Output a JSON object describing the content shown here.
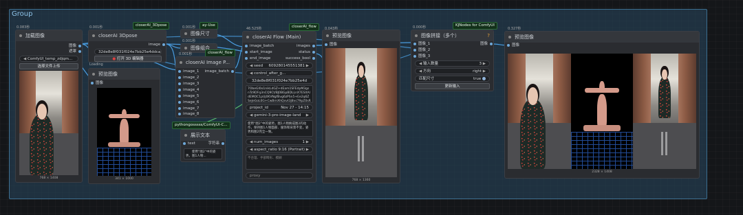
{
  "group": {
    "title": "Group"
  },
  "nodes": {
    "load_image": {
      "timer": "0.083秒",
      "title": "加载图像",
      "out_image": "图像",
      "out_mask": "遮罩",
      "file": "ComfyUI_temp_zdjqm...",
      "upload": "选择文件上传",
      "caption": "768 × 1408"
    },
    "load3d": {
      "timer": "0.001秒",
      "badge": "closerAI_3Dpose",
      "title": "closerAI 3Dpose",
      "out_image": "image",
      "hash": "32de8e8f031f024e7bb25e4ddca...",
      "open_editor": "打开 3D 编辑器",
      "extra": "Loading"
    },
    "preview_left": {
      "title": "预览图像",
      "in_images": "图像",
      "caption": "341 × 1000"
    },
    "image_size": {
      "timer": "0.001秒",
      "badge_fragment": "ay-Use",
      "title": "图像尺寸"
    },
    "image_combine": {
      "timer": "0.001秒",
      "title": "图像组合"
    },
    "closerai_image": {
      "timer": "0.001秒",
      "badge": "closerAI_flow",
      "title": "closerAI Image P...",
      "inputs": [
        "image_1",
        "image_2",
        "image_3",
        "image_4",
        "image_5",
        "image_6",
        "image_7",
        "image_8"
      ],
      "out": "image_batch"
    },
    "show_text": {
      "badge": "pythongosssss/ComfyUI-C...",
      "title": "展示文本",
      "in_text": "text",
      "out_text": "字符串",
      "content": "　　使用“图2”中的姿势，图1人物..."
    },
    "closerai_flow": {
      "timer": "46.525秒",
      "badge": "closerAI_flow",
      "title": "closerAI Flow (Main)",
      "inputs": [
        "image_batch",
        "start_image",
        "end_image"
      ],
      "outputs": [
        "images",
        "status",
        "success_bool"
      ],
      "seed_label": "seed",
      "seed_value": "609280145551381",
      "cafter_label": "control_after_g...",
      "cafter_value": "randomize",
      "hash": "32de8e8f031f024e7bb25e4d",
      "payload": "7ObeGl0o1nikLdGZ+dEam1SFEdpM3gsnTc9DFq3nCQ9Ct/BJ0BGpBDLLnX7ESXAldEMOC1pUj0KVNgfBvg6zPSn5+Ee2q6ZSeJeGoL0G+CwBrnXhQxvt3j8vc79pZ0sRaQ5rF2NsBbuJtOqWvMFuh1CXpOq",
      "project_id_label": "project_id",
      "project_id_value": "Nov 27 - 14:15",
      "model": "gemini-3-pro-image-land",
      "prompt": "使用“图2”中的姿势，图1人物换成图2的动作，保持图1人物面部、服饰和背景不变，姿势和图2完全一致。",
      "num_images_label": "num_images",
      "num_images_value": "1",
      "aspect_ratio_label": "aspect_ratio",
      "aspect_ratio_value": "9:16 (Portrait)",
      "negative": "不合理、手部畸形、模糊",
      "proxy": "proxy"
    },
    "preview_center": {
      "timer": "0.043秒",
      "title": "预览图像",
      "in_images": "图像",
      "caption": "768 × 1360"
    },
    "image_stitch": {
      "timer": "0.000秒",
      "badge": "KJNodes for ComfyUI",
      "title": "图像拼接（多个）",
      "inputs": [
        "图像_1",
        "图像_2",
        "图像_3"
      ],
      "out": "图像",
      "w_inputs_label": "输入数量",
      "w_inputs_value": "3",
      "w_dir_label": "方向",
      "w_dir_value": "right",
      "w_match_label": "匹配尺寸",
      "w_match_value": "true",
      "update": "更新输入"
    },
    "preview_right": {
      "timer": "0.327秒",
      "title": "预览图像",
      "in_images": "图像",
      "caption": "2328 × 1408"
    }
  },
  "colors": {
    "wire": "#4a9de0",
    "group_border": "#3d6f91",
    "badge_bg": "#13301a"
  }
}
